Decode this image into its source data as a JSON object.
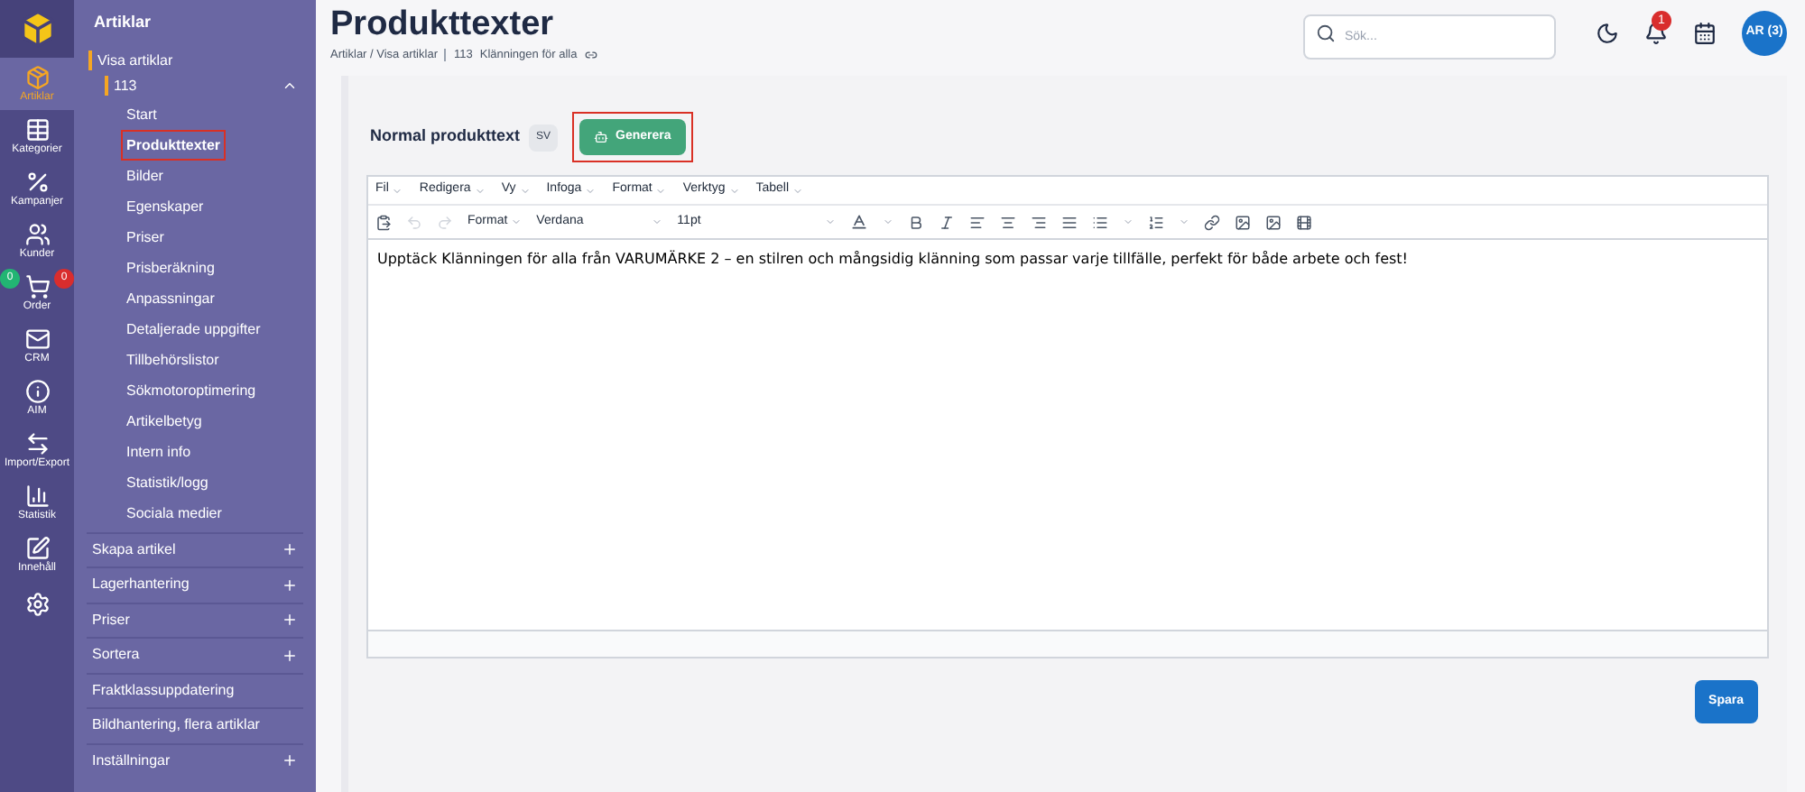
{
  "rail": [
    {
      "kind": "logo"
    },
    {
      "kind": "item",
      "label": "Artiklar",
      "selected": true
    },
    {
      "kind": "item",
      "label": "Kategorier",
      "selected": false
    },
    {
      "kind": "item",
      "label": "Kampanjer",
      "selected": false
    },
    {
      "kind": "item",
      "label": "Kunder",
      "selected": false
    },
    {
      "kind": "item",
      "label": "Order",
      "selected": false,
      "badges": [
        {
          "text": "0",
          "color": "#22b573"
        },
        {
          "text": "0",
          "color": "#d92d2d"
        }
      ]
    },
    {
      "kind": "item",
      "label": "CRM",
      "selected": false
    },
    {
      "kind": "item",
      "label": "AIM",
      "selected": false
    },
    {
      "kind": "item",
      "label": "Import/Export",
      "selected": false
    },
    {
      "kind": "item",
      "label": "Statistik",
      "selected": false
    },
    {
      "kind": "item",
      "label": "Innehåll",
      "selected": false
    },
    {
      "kind": "gear"
    }
  ],
  "nav": {
    "title": "Artiklar",
    "section": "Visa artiklar",
    "item": {
      "label": "113",
      "expanded": true,
      "children": [
        {
          "label": "Start",
          "selected": false
        },
        {
          "label": "Produkttexter",
          "selected": true
        },
        {
          "label": "Bilder",
          "selected": false
        },
        {
          "label": "Egenskaper",
          "selected": false
        },
        {
          "label": "Priser",
          "selected": false
        },
        {
          "label": "Prisberäkning",
          "selected": false
        },
        {
          "label": "Anpassningar",
          "selected": false
        },
        {
          "label": "Detaljerade uppgifter",
          "selected": false
        },
        {
          "label": "Tillbehörslistor",
          "selected": false
        },
        {
          "label": "Sökmotoroptimering",
          "selected": false
        },
        {
          "label": "Artikelbetyg",
          "selected": false
        },
        {
          "label": "Intern info",
          "selected": false
        },
        {
          "label": "Statistik/logg",
          "selected": false
        },
        {
          "label": "Sociala medier",
          "selected": false
        }
      ]
    },
    "groups": [
      {
        "label": "Skapa artikel",
        "expandable": true
      },
      {
        "label": "Lagerhantering",
        "expandable": true
      },
      {
        "label": "Priser",
        "expandable": true
      },
      {
        "label": "Sortera",
        "expandable": true
      },
      {
        "label": "Fraktklassuppdatering",
        "expandable": false
      },
      {
        "label": "Bildhantering, flera artiklar",
        "expandable": false
      },
      {
        "label": "Inställningar",
        "expandable": true
      }
    ]
  },
  "header": {
    "title": "Produkttexter",
    "breadcrumb": "Artiklar / Visa artiklar",
    "article_number": "113",
    "article_name": "Klänningen för alla",
    "search": {
      "placeholder": "Sök..."
    },
    "notifications": "1",
    "avatar": "AR (3)"
  },
  "editor": {
    "label": "Normal produkttext",
    "language": "SV",
    "generate_button": "Generera",
    "menus": [
      "Fil",
      "Redigera",
      "Vy",
      "Infoga",
      "Format",
      "Verktyg",
      "Tabell"
    ],
    "format_menu": "Format",
    "font": "Verdana",
    "size": "11pt",
    "content": "Upptäck Klänningen för alla från VARUMÄRKE 2 – en stilren och mångsidig klänning som passar varje tillfälle, perfekt för både arbete och fest!"
  },
  "save_button": "Spara"
}
